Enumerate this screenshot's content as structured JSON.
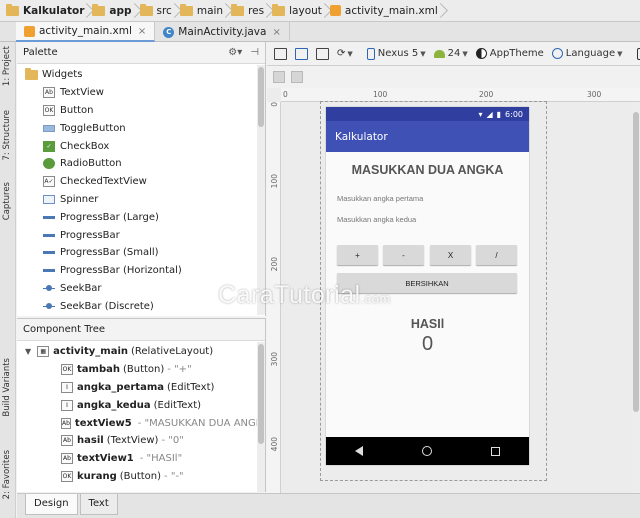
{
  "breadcrumbs": [
    "Kalkulator",
    "app",
    "src",
    "main",
    "res",
    "layout",
    "activity_main.xml"
  ],
  "file_tabs": [
    {
      "label": "activity_main.xml",
      "active": true
    },
    {
      "label": "MainActivity.java",
      "active": false
    }
  ],
  "side_tabs": [
    "1: Project",
    "7: Structure",
    "Captures",
    "Build Variants",
    "2: Favorites"
  ],
  "palette": {
    "title": "Palette",
    "group": "Widgets",
    "items": [
      {
        "label": "TextView",
        "icon": "textview-icon",
        "glyph": "Ab"
      },
      {
        "label": "Button",
        "icon": "button-icon",
        "glyph": "OK"
      },
      {
        "label": "ToggleButton",
        "icon": "togglebutton-icon",
        "glyph": ""
      },
      {
        "label": "CheckBox",
        "icon": "checkbox-icon",
        "glyph": "✓"
      },
      {
        "label": "RadioButton",
        "icon": "radiobutton-icon",
        "glyph": ""
      },
      {
        "label": "CheckedTextView",
        "icon": "checkedtextview-icon",
        "glyph": "A✓"
      },
      {
        "label": "Spinner",
        "icon": "spinner-icon",
        "glyph": ""
      },
      {
        "label": "ProgressBar (Large)",
        "icon": "progressbar-icon",
        "glyph": ""
      },
      {
        "label": "ProgressBar",
        "icon": "progressbar-icon",
        "glyph": ""
      },
      {
        "label": "ProgressBar (Small)",
        "icon": "progressbar-icon",
        "glyph": ""
      },
      {
        "label": "ProgressBar (Horizontal)",
        "icon": "progressbar-icon",
        "glyph": ""
      },
      {
        "label": "SeekBar",
        "icon": "seekbar-icon",
        "glyph": ""
      },
      {
        "label": "SeekBar (Discrete)",
        "icon": "seekbar-icon",
        "glyph": ""
      }
    ]
  },
  "component_tree": {
    "title": "Component Tree",
    "root": {
      "name": "activity_main",
      "type": "(RelativeLayout)"
    },
    "children": [
      {
        "name": "tambah",
        "type": "(Button)",
        "value": "- \"+\"",
        "glyph": "OK"
      },
      {
        "name": "angka_pertama",
        "type": "(EditText)",
        "value": "",
        "glyph": "I"
      },
      {
        "name": "angka_kedua",
        "type": "(EditText)",
        "value": "",
        "glyph": "I"
      },
      {
        "name": "textView5",
        "type": "",
        "value": "- \"MASUKKAN DUA ANGKA\"",
        "glyph": "Ab"
      },
      {
        "name": "hasil",
        "type": "(TextView)",
        "value": "- \"0\"",
        "glyph": "Ab"
      },
      {
        "name": "textView1",
        "type": "",
        "value": "- \"HASIl\"",
        "glyph": "Ab"
      },
      {
        "name": "kurang",
        "type": "(Button)",
        "value": "- \"-\"",
        "glyph": "OK"
      }
    ]
  },
  "toolbar": {
    "device": "Nexus 5",
    "api": "24",
    "theme": "AppTheme",
    "language": "Language"
  },
  "ruler": {
    "top": [
      "0",
      "100",
      "200",
      "300"
    ],
    "left": [
      "0",
      "100",
      "200",
      "300",
      "400"
    ]
  },
  "phone": {
    "time": "6:00",
    "app_title": "Kalkulator",
    "heading": "MASUKKAN DUA ANGKA",
    "hint1": "Masukkan angka pertama",
    "hint2": "Masukkan angka kedua",
    "buttons": [
      "+",
      "-",
      "X",
      "/"
    ],
    "clear": "BERSIHKAN",
    "result_label": "HASIl",
    "result_value": "0"
  },
  "bottom_tabs": [
    {
      "label": "Design",
      "active": true
    },
    {
      "label": "Text",
      "active": false
    }
  ],
  "watermark": {
    "main": "CaraTutorial",
    "suffix": ".com"
  }
}
